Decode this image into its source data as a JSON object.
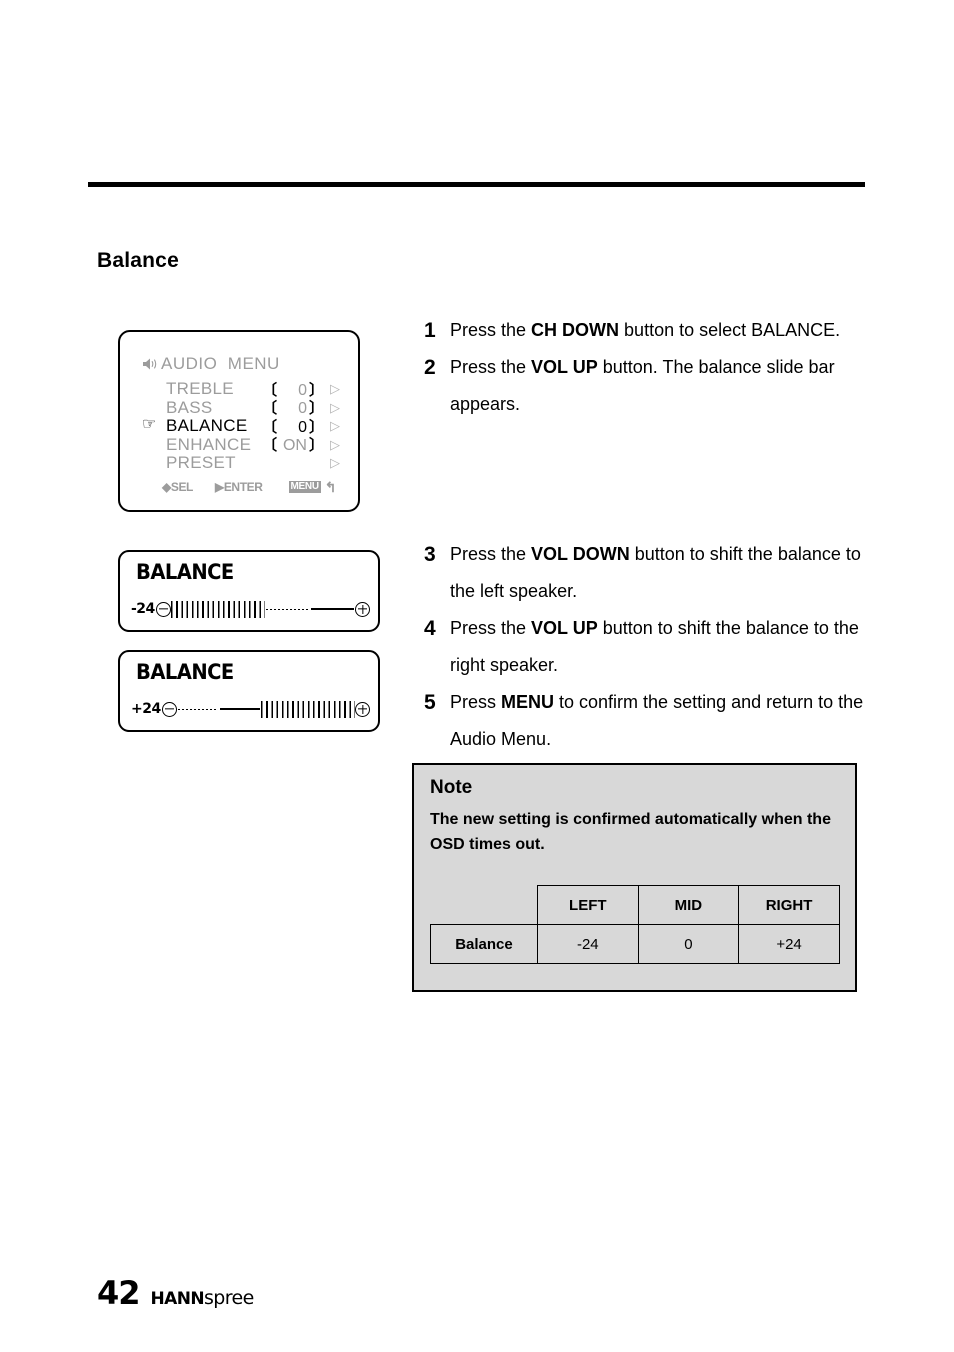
{
  "page": {
    "section_title": "Balance",
    "page_number": "42",
    "brand_bold": "HANN",
    "brand_light": "spree"
  },
  "osd_menu": {
    "icon": "speaker-icon",
    "title": "AUDIO  MENU",
    "pointer_glyph": "☞",
    "rows": [
      {
        "label": "TREBLE",
        "open": "〔",
        "value": "0",
        "close": "〕",
        "arrow": "▷",
        "active": false
      },
      {
        "label": "BASS",
        "open": "〔",
        "value": "0",
        "close": "〕",
        "arrow": "▷",
        "active": false
      },
      {
        "label": "BALANCE",
        "open": "〔",
        "value": "0",
        "close": "〕",
        "arrow": "▷",
        "active": true
      },
      {
        "label": "ENHANCE",
        "open": "〔",
        "value": "ON",
        "close": "〕",
        "arrow": "▷",
        "active": false
      },
      {
        "label": "PRESET",
        "open": "",
        "value": "",
        "close": "",
        "arrow": "▷",
        "active": false
      }
    ],
    "footer": {
      "sel_glyph": "◆",
      "sel_label": "SEL",
      "enter_glyph": "▶",
      "enter_label": "ENTER",
      "menu_label": "MENU",
      "return_glyph": "↰"
    }
  },
  "balance_bars": [
    {
      "name": "balance-bar-left",
      "title": "BALANCE",
      "amount": "-24",
      "minus_icon": "minus-circle-icon",
      "plus_icon": "plus-circle-icon",
      "filled_side": "left"
    },
    {
      "name": "balance-bar-right",
      "title": "BALANCE",
      "amount": "+24",
      "minus_icon": "minus-circle-icon",
      "plus_icon": "plus-circle-icon",
      "filled_side": "right"
    }
  ],
  "steps_group_1": [
    {
      "num": "1",
      "parts": [
        {
          "t": "Press the ",
          "b": false
        },
        {
          "t": "CH DOWN",
          "b": true
        },
        {
          "t": " button to select BALANCE.",
          "b": false
        }
      ]
    },
    {
      "num": "2",
      "parts": [
        {
          "t": "Press the ",
          "b": false
        },
        {
          "t": "VOL UP",
          "b": true
        },
        {
          "t": " button. The balance slide bar appears.",
          "b": false
        }
      ]
    }
  ],
  "steps_group_2": [
    {
      "num": "3",
      "parts": [
        {
          "t": "Press the ",
          "b": false
        },
        {
          "t": "VOL DOWN",
          "b": true
        },
        {
          "t": " button to shift the balance to the left speaker.",
          "b": false
        }
      ]
    },
    {
      "num": "4",
      "parts": [
        {
          "t": "Press the ",
          "b": false
        },
        {
          "t": "VOL UP",
          "b": true
        },
        {
          "t": " button to shift the balance to the right speaker.",
          "b": false
        }
      ]
    },
    {
      "num": "5",
      "parts": [
        {
          "t": "Press ",
          "b": false
        },
        {
          "t": "MENU",
          "b": true
        },
        {
          "t": " to confirm the setting and return to the Audio Menu.",
          "b": false
        }
      ]
    }
  ],
  "note": {
    "title": "Note",
    "body": "The new setting is confirmed automatically when the OSD times out.",
    "table": {
      "headers": [
        "",
        "LEFT",
        "MID",
        "RIGHT"
      ],
      "rows": [
        {
          "label": "Balance",
          "values": [
            "-24",
            "0",
            "+24"
          ]
        }
      ]
    }
  }
}
